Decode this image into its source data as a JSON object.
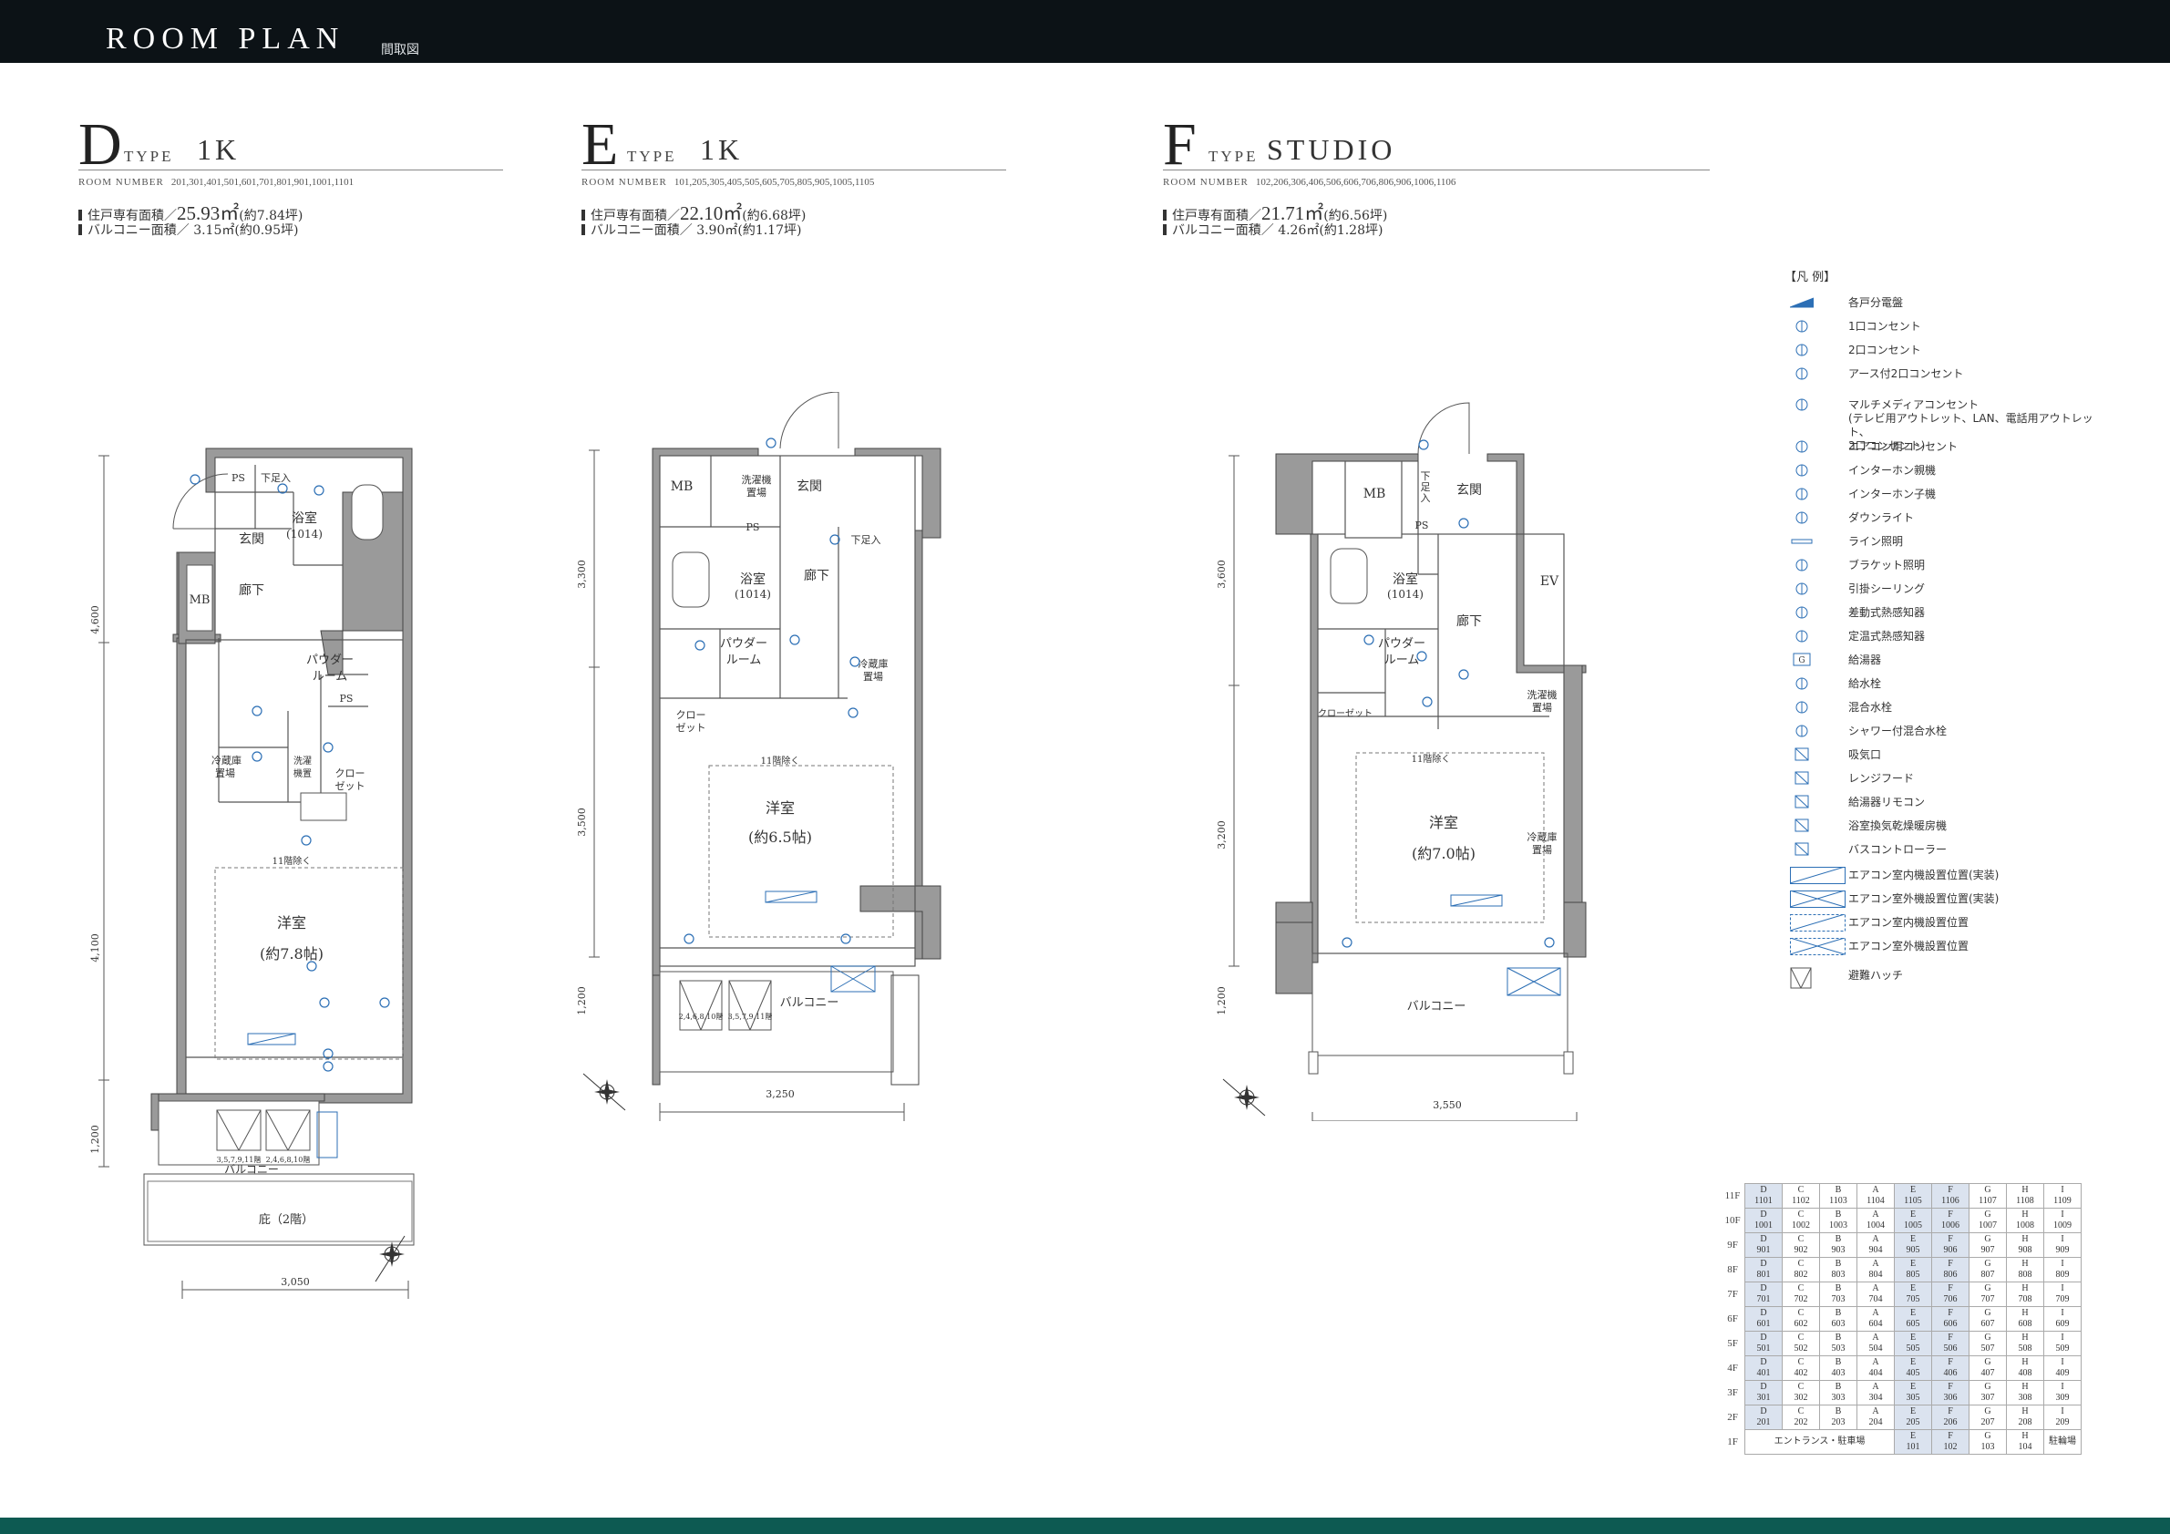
{
  "header": {
    "title": "ROOM PLAN",
    "subtitle": "間取図"
  },
  "types": [
    {
      "letter": "D",
      "type_label": "TYPE",
      "plan": "1K",
      "room_number_label": "ROOM NUMBER",
      "room_numbers": "201,301,401,501,601,701,801,901,1001,1101",
      "area_label": "住戸専有面積／",
      "area_value": "25.93㎡",
      "area_tsubo": "(約7.84坪)",
      "balcony_label": "バルコニー面積／",
      "balcony_value": "3.15㎡(約0.95坪)"
    },
    {
      "letter": "E",
      "type_label": "TYPE",
      "plan": "1K",
      "room_number_label": "ROOM NUMBER",
      "room_numbers": "101,205,305,405,505,605,705,805,905,1005,1105",
      "area_label": "住戸専有面積／",
      "area_value": "22.10㎡",
      "area_tsubo": "(約6.68坪)",
      "balcony_label": "バルコニー面積／",
      "balcony_value": "3.90㎡(約1.17坪)"
    },
    {
      "letter": "F",
      "type_label": "TYPE",
      "plan": "STUDIO",
      "room_number_label": "ROOM NUMBER",
      "room_numbers": "102,206,306,406,506,606,706,806,906,1006,1106",
      "area_label": "住戸専有面積／",
      "area_value": "21.71㎡",
      "area_tsubo": "(約6.56坪)",
      "balcony_label": "バルコニー面積／",
      "balcony_value": "4.26㎡(約1.28坪)"
    }
  ],
  "plans": {
    "d": {
      "ps1": "PS",
      "shoe": "下足入",
      "bath": "浴室",
      "bath_size": "(1014)",
      "entry": "玄関",
      "mb": "MB",
      "hall": "廊下",
      "powder1": "パウダー",
      "powder2": "ルーム",
      "fridge1": "冷蔵庫",
      "fridge2": "置場",
      "washer1": "洗濯",
      "washer2": "機置",
      "closet1": "クロー",
      "closet2": "ゼット",
      "ps2": "PS",
      "ceiling": "11階除く",
      "room": "洋室",
      "room_size": "(約7.8帖)",
      "hatch1": "3,5,7,9,11階",
      "hatch2": "2,4,6,8,10階",
      "balcony": "バルコニー",
      "eaves": "庇（2階）",
      "dim_v1": "4,600",
      "dim_v2": "4,100",
      "dim_v3": "1,200",
      "dim_h": "3,050"
    },
    "e": {
      "mb": "MB",
      "washer1": "洗濯機",
      "washer2": "置場",
      "entry": "玄関",
      "ps": "PS",
      "shoe": "下足入",
      "bath": "浴室",
      "bath_size": "(1014)",
      "hall": "廊下",
      "powder1": "パウダー",
      "powder2": "ルーム",
      "fridge1": "冷蔵庫",
      "fridge2": "置場",
      "closet1": "クロー",
      "closet2": "ゼット",
      "ceiling": "11階除く",
      "room": "洋室",
      "room_size": "(約6.5帖)",
      "hatch1": "2,4,6,8,10階",
      "hatch2": "3,5,7,9,11階",
      "balcony": "バルコニー",
      "dim_v1": "3,300",
      "dim_v2": "3,500",
      "dim_v3": "1,200",
      "dim_h": "3,250"
    },
    "f": {
      "mb": "MB",
      "shoe1": "下",
      "shoe2": "足",
      "shoe3": "入",
      "entry": "玄関",
      "ps": "PS",
      "ev": "EV",
      "bath": "浴室",
      "bath_size": "(1014)",
      "hall": "廊下",
      "powder1": "パウダー",
      "powder2": "ルーム",
      "closet": "クローゼット",
      "washer1": "洗濯機",
      "washer2": "置場",
      "ceiling": "11階除く",
      "room": "洋室",
      "room_size": "(約7.0帖)",
      "fridge1": "冷蔵庫",
      "fridge2": "置場",
      "balcony": "バルコニー",
      "dim_v1": "3,600",
      "dim_v2": "3,200",
      "dim_v3": "1,200",
      "dim_h": "3,550"
    }
  },
  "legend": {
    "title": "【凡 例】",
    "items": [
      {
        "icon": "distribution-board-icon",
        "label": "各戸分電盤"
      },
      {
        "icon": "outlet-1-icon",
        "label": "1口コンセント"
      },
      {
        "icon": "outlet-2-icon",
        "label": "2口コンセント"
      },
      {
        "icon": "outlet-earth-icon",
        "label": "アース付2口コンセント"
      },
      {
        "icon": "multimedia-outlet-icon",
        "label": "マルチメディアコンセント\n(テレビ用アウトレット、LAN、電話用アウトレット、\n2口コンセント)"
      },
      {
        "icon": "aircon-outlet-icon",
        "label": "エアコン用コンセント"
      },
      {
        "icon": "intercom-main-icon",
        "label": "インターホン親機"
      },
      {
        "icon": "intercom-sub-icon",
        "label": "インターホン子機"
      },
      {
        "icon": "downlight-icon",
        "label": "ダウンライト"
      },
      {
        "icon": "line-light-icon",
        "label": "ライン照明"
      },
      {
        "icon": "bracket-light-icon",
        "label": "ブラケット照明"
      },
      {
        "icon": "ceiling-hook-icon",
        "label": "引掛シーリング"
      },
      {
        "icon": "rate-of-rise-detector-icon",
        "label": "差動式熱感知器"
      },
      {
        "icon": "fixed-temp-detector-icon",
        "label": "定温式熱感知器"
      },
      {
        "icon": "water-heater-icon",
        "label": "給湯器"
      },
      {
        "icon": "water-tap-icon",
        "label": "給水栓"
      },
      {
        "icon": "mixing-tap-icon",
        "label": "混合水栓"
      },
      {
        "icon": "shower-tap-icon",
        "label": "シャワー付混合水栓"
      },
      {
        "icon": "air-intake-icon",
        "label": "吸気口"
      },
      {
        "icon": "range-hood-icon",
        "label": "レンジフード"
      },
      {
        "icon": "heater-remote-icon",
        "label": "給湯器リモコン"
      },
      {
        "icon": "bath-dryer-icon",
        "label": "浴室換気乾燥暖房機"
      },
      {
        "icon": "bath-controller-icon",
        "label": "バスコントローラー"
      },
      {
        "icon": "aircon-indoor-installed-icon",
        "label": "エアコン室内機設置位置(実装)"
      },
      {
        "icon": "aircon-outdoor-installed-icon",
        "label": "エアコン室外機設置位置(実装)"
      },
      {
        "icon": "aircon-indoor-position-icon",
        "label": "エアコン室内機設置位置"
      },
      {
        "icon": "aircon-outdoor-position-icon",
        "label": "エアコン室外機設置位置"
      },
      {
        "icon": "escape-hatch-icon",
        "label": "避難ハッチ"
      }
    ]
  },
  "floor_table": {
    "rows": [
      {
        "floor": "11F",
        "units": [
          [
            "D",
            "1101"
          ],
          [
            "C",
            "1102"
          ],
          [
            "B",
            "1103"
          ],
          [
            "A",
            "1104"
          ],
          [
            "E",
            "1105"
          ],
          [
            "F",
            "1106"
          ],
          [
            "G",
            "1107"
          ],
          [
            "H",
            "1108"
          ],
          [
            "I",
            "1109"
          ]
        ]
      },
      {
        "floor": "10F",
        "units": [
          [
            "D",
            "1001"
          ],
          [
            "C",
            "1002"
          ],
          [
            "B",
            "1003"
          ],
          [
            "A",
            "1004"
          ],
          [
            "E",
            "1005"
          ],
          [
            "F",
            "1006"
          ],
          [
            "G",
            "1007"
          ],
          [
            "H",
            "1008"
          ],
          [
            "I",
            "1009"
          ]
        ]
      },
      {
        "floor": "9F",
        "units": [
          [
            "D",
            "901"
          ],
          [
            "C",
            "902"
          ],
          [
            "B",
            "903"
          ],
          [
            "A",
            "904"
          ],
          [
            "E",
            "905"
          ],
          [
            "F",
            "906"
          ],
          [
            "G",
            "907"
          ],
          [
            "H",
            "908"
          ],
          [
            "I",
            "909"
          ]
        ]
      },
      {
        "floor": "8F",
        "units": [
          [
            "D",
            "801"
          ],
          [
            "C",
            "802"
          ],
          [
            "B",
            "803"
          ],
          [
            "A",
            "804"
          ],
          [
            "E",
            "805"
          ],
          [
            "F",
            "806"
          ],
          [
            "G",
            "807"
          ],
          [
            "H",
            "808"
          ],
          [
            "I",
            "809"
          ]
        ]
      },
      {
        "floor": "7F",
        "units": [
          [
            "D",
            "701"
          ],
          [
            "C",
            "702"
          ],
          [
            "B",
            "703"
          ],
          [
            "A",
            "704"
          ],
          [
            "E",
            "705"
          ],
          [
            "F",
            "706"
          ],
          [
            "G",
            "707"
          ],
          [
            "H",
            "708"
          ],
          [
            "I",
            "709"
          ]
        ]
      },
      {
        "floor": "6F",
        "units": [
          [
            "D",
            "601"
          ],
          [
            "C",
            "602"
          ],
          [
            "B",
            "603"
          ],
          [
            "A",
            "604"
          ],
          [
            "E",
            "605"
          ],
          [
            "F",
            "606"
          ],
          [
            "G",
            "607"
          ],
          [
            "H",
            "608"
          ],
          [
            "I",
            "609"
          ]
        ]
      },
      {
        "floor": "5F",
        "units": [
          [
            "D",
            "501"
          ],
          [
            "C",
            "502"
          ],
          [
            "B",
            "503"
          ],
          [
            "A",
            "504"
          ],
          [
            "E",
            "505"
          ],
          [
            "F",
            "506"
          ],
          [
            "G",
            "507"
          ],
          [
            "H",
            "508"
          ],
          [
            "I",
            "509"
          ]
        ]
      },
      {
        "floor": "4F",
        "units": [
          [
            "D",
            "401"
          ],
          [
            "C",
            "402"
          ],
          [
            "B",
            "403"
          ],
          [
            "A",
            "404"
          ],
          [
            "E",
            "405"
          ],
          [
            "F",
            "406"
          ],
          [
            "G",
            "407"
          ],
          [
            "H",
            "408"
          ],
          [
            "I",
            "409"
          ]
        ]
      },
      {
        "floor": "3F",
        "units": [
          [
            "D",
            "301"
          ],
          [
            "C",
            "302"
          ],
          [
            "B",
            "303"
          ],
          [
            "A",
            "304"
          ],
          [
            "E",
            "305"
          ],
          [
            "F",
            "306"
          ],
          [
            "G",
            "307"
          ],
          [
            "H",
            "308"
          ],
          [
            "I",
            "309"
          ]
        ]
      },
      {
        "floor": "2F",
        "units": [
          [
            "D",
            "201"
          ],
          [
            "C",
            "202"
          ],
          [
            "B",
            "203"
          ],
          [
            "A",
            "204"
          ],
          [
            "E",
            "205"
          ],
          [
            "F",
            "206"
          ],
          [
            "G",
            "207"
          ],
          [
            "H",
            "208"
          ],
          [
            "I",
            "209"
          ]
        ]
      }
    ],
    "first_floor": {
      "floor": "1F",
      "entrance": "エントランス・駐車場",
      "units": [
        [
          "E",
          "101"
        ],
        [
          "F",
          "102"
        ],
        [
          "G",
          "103"
        ],
        [
          "H",
          "104"
        ]
      ],
      "parking": "駐輪場"
    },
    "highlight_types": [
      "D",
      "E",
      "F"
    ],
    "highlight_color": "#dbe3ef"
  },
  "colors": {
    "header_bg": "#0c1216",
    "footer_bg": "#0d5a52",
    "wall": "#9a9a9a",
    "symbol_blue": "#2c6fb5"
  }
}
